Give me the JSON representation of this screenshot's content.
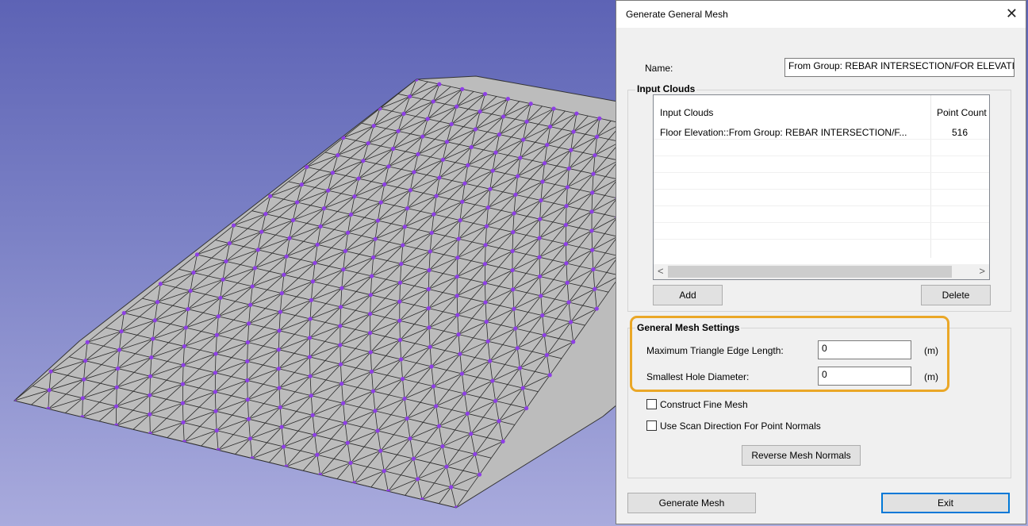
{
  "dialog": {
    "title": "Generate General Mesh",
    "close_glyph": "✕",
    "name_label": "Name:",
    "name_value": "From Group: REBAR INTERSECTION/FOR ELEVATION",
    "input_clouds_group": "Input Clouds",
    "list": {
      "columns": [
        "Input Clouds",
        "Point Count"
      ],
      "rows": [
        {
          "cloud": "Floor Elevation::From Group: REBAR INTERSECTION/F...",
          "count": "516"
        }
      ],
      "scroll_left": "<",
      "scroll_right": ">"
    },
    "add_label": "Add",
    "delete_label": "Delete",
    "settings_group": "General Mesh Settings",
    "max_edge_label": "Maximum Triangle Edge Length:",
    "max_edge_value": "0",
    "max_edge_unit": "(m)",
    "hole_label": "Smallest Hole Diameter:",
    "hole_value": "0",
    "hole_unit": "(m)",
    "fine_mesh_label": "Construct Fine Mesh",
    "scan_dir_label": "Use Scan Direction For Point Normals",
    "reverse_label": "Reverse Mesh Normals",
    "generate_label": "Generate Mesh",
    "exit_label": "Exit"
  },
  "colors": {
    "mesh_fill": "#bcbcbc",
    "mesh_point": "#8e3fe6",
    "highlight": "#eaa727"
  },
  "icons": [
    "close-icon",
    "checkbox-icon",
    "scroll-left-icon",
    "scroll-right-icon"
  ]
}
